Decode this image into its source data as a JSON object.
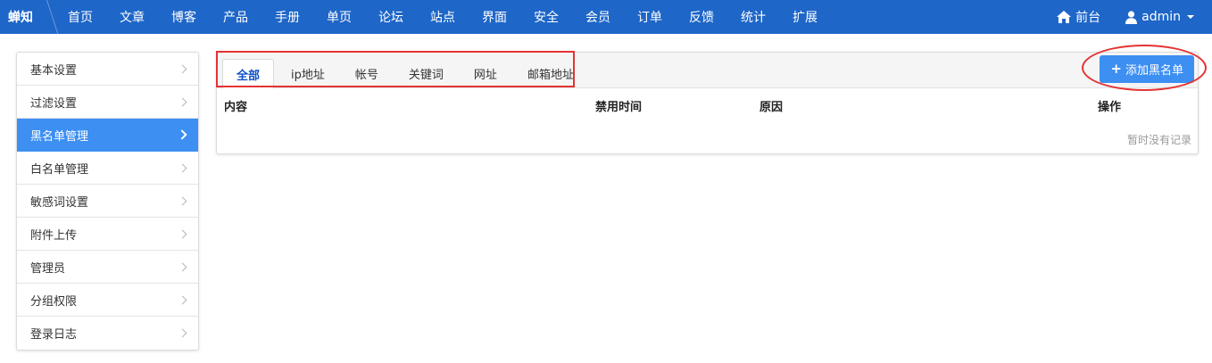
{
  "brand": "蝉知",
  "nav": [
    "首页",
    "文章",
    "博客",
    "产品",
    "手册",
    "单页",
    "论坛",
    "站点",
    "界面",
    "安全",
    "会员",
    "订单",
    "反馈",
    "统计",
    "扩展"
  ],
  "nav_right": {
    "frontend_label": "前台",
    "user_label": "admin"
  },
  "sidebar": {
    "items": [
      {
        "label": "基本设置"
      },
      {
        "label": "过滤设置"
      },
      {
        "label": "黑名单管理"
      },
      {
        "label": "白名单管理"
      },
      {
        "label": "敏感词设置"
      },
      {
        "label": "附件上传"
      },
      {
        "label": "管理员"
      },
      {
        "label": "分组权限"
      },
      {
        "label": "登录日志"
      }
    ],
    "active_index": 2
  },
  "tabs": [
    "全部",
    "ip地址",
    "帐号",
    "关键词",
    "网址",
    "邮箱地址"
  ],
  "active_tab_index": 0,
  "add_button_label": "添加黑名单",
  "table": {
    "columns": [
      "内容",
      "禁用时间",
      "原因",
      "操作"
    ],
    "empty_text": "暂时没有记录"
  },
  "colors": {
    "topbar": "#1e66c8",
    "accent": "#3d8ff2",
    "highlight": "#e53333"
  },
  "icons": {
    "frontend": "home-icon",
    "user": "user-icon",
    "add": "plus-icon"
  }
}
